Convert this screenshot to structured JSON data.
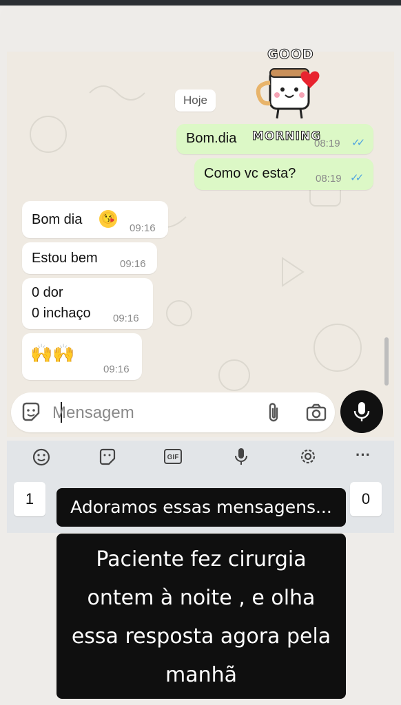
{
  "chat": {
    "date_label": "Hoje",
    "messages": [
      {
        "text": "Bom.dia",
        "time": "08:19",
        "dir": "out"
      },
      {
        "text": "Como vc esta?",
        "time": "08:19",
        "dir": "out"
      },
      {
        "text": "Bom dia",
        "time": "09:16",
        "dir": "in",
        "emoji": "kiss-face"
      },
      {
        "text": "Estou bem",
        "time": "09:16",
        "dir": "in"
      },
      {
        "lines": [
          "0 dor",
          "0 inchaço"
        ],
        "time": "09:16",
        "dir": "in"
      },
      {
        "text": "",
        "time": "09:16",
        "dir": "in",
        "emoji": "raising-hands x2"
      }
    ],
    "sticker": {
      "top": "GOOD",
      "bottom": "MORNING"
    }
  },
  "input": {
    "placeholder": "Mensagem"
  },
  "keyboard": {
    "icons": [
      "emoji-icon",
      "sticker-icon",
      "gif-icon",
      "mic-icon",
      "settings-icon",
      "more-icon"
    ],
    "keys": [
      "1",
      "0"
    ],
    "gif_label": "GIF",
    "more_label": "···"
  },
  "captions": {
    "line1": "Adoramos essas mensagens...",
    "line2": [
      "Paciente fez cirurgia",
      "ontem à noite , e olha",
      "essa resposta agora pela",
      "manhã"
    ]
  },
  "colors": {
    "outgoing_bubble": "#dcf8c6",
    "incoming_bubble": "#ffffff",
    "chat_bg": "#efeae2",
    "read_ticks": "#4fa3e0",
    "caption_bg": "#0f0f0f"
  }
}
